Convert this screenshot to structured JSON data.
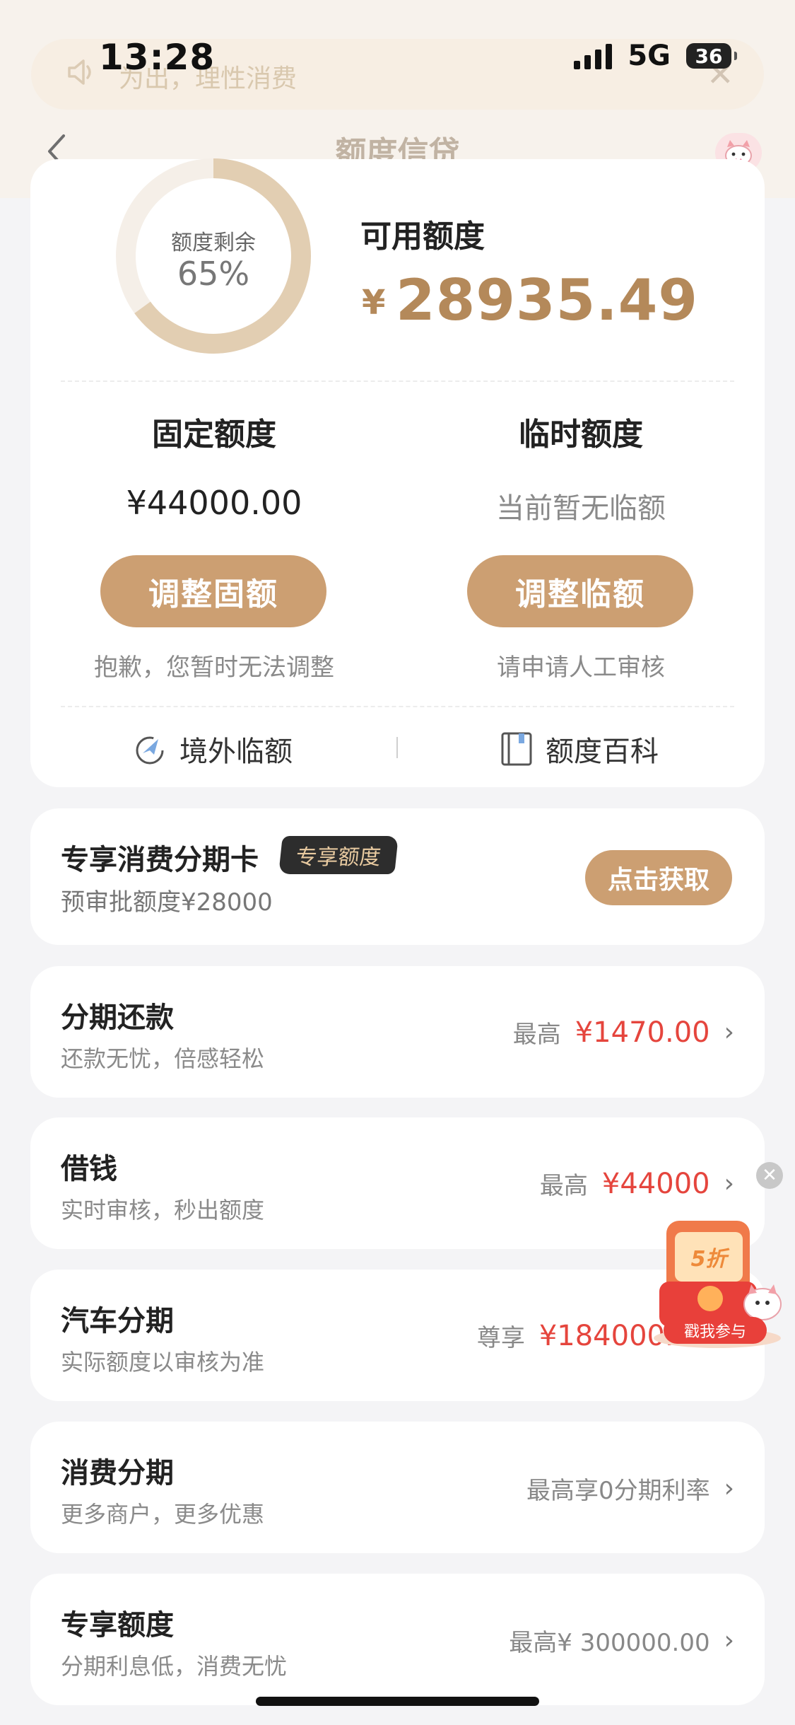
{
  "status": {
    "time": "13:28",
    "network": "5G",
    "battery": "36"
  },
  "notice": {
    "text": "为出，理性消费"
  },
  "header": {
    "title": "额度信贷"
  },
  "credit": {
    "ring_label": "额度剩余",
    "ring_percent": "65%",
    "ring_fraction": 0.65,
    "available_label": "可用额度",
    "available_currency": "¥",
    "available_amount": "28935.49",
    "fixed": {
      "title": "固定额度",
      "value": "¥44000.00",
      "button": "调整固额",
      "note": "抱歉，您暂时无法调整"
    },
    "temp": {
      "title": "临时额度",
      "value": "当前暂无临额",
      "button": "调整临额",
      "note": "请申请人工审核"
    },
    "links": {
      "overseas": "境外临额",
      "wiki": "额度百科"
    }
  },
  "promo": {
    "title": "专享消费分期卡",
    "badge": "专享额度",
    "subtitle": "预审批额度¥28000",
    "button": "点击获取"
  },
  "items": [
    {
      "title": "分期还款",
      "subtitle": "还款无忧，倍感轻松",
      "prefix": "最高",
      "amount": "¥1470.00"
    },
    {
      "title": "借钱",
      "subtitle": "实时审核，秒出额度",
      "prefix": "最高",
      "amount": "¥44000"
    },
    {
      "title": "汽车分期",
      "subtitle": "实际额度以审核为准",
      "prefix": "尊享",
      "amount": "¥184000.00"
    },
    {
      "title": "消费分期",
      "subtitle": "更多商户，更多优惠",
      "prefix": "最高享0分期利率",
      "amount": ""
    },
    {
      "title": "专享额度",
      "subtitle": "分期利息低，消费无忧",
      "prefix": "最高¥ 300000.00",
      "amount": ""
    }
  ],
  "float_promo": {
    "discount": "5折",
    "button": "戳我参与"
  },
  "colors": {
    "accent": "#cc9f72",
    "amount_gold": "#b4895a",
    "red": "#e5453d"
  }
}
